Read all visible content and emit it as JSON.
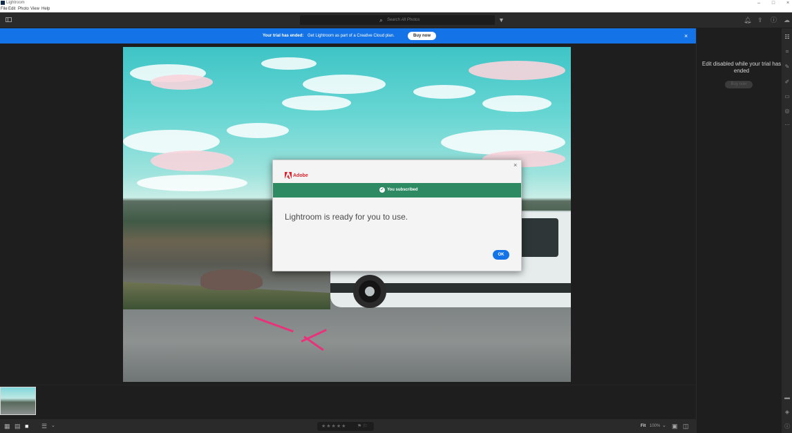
{
  "window": {
    "title": "Lightroom",
    "minimize": "–",
    "maximize": "□",
    "close": "×"
  },
  "menu": [
    "File",
    "Edit",
    "Photo",
    "View",
    "Help"
  ],
  "toolbar": {
    "search_placeholder": "Search All Photos",
    "icons": [
      "panel-toggle-icon",
      "search-icon",
      "filter-icon",
      "bell-icon",
      "share-icon",
      "help-icon",
      "cloud-icon"
    ]
  },
  "banner": {
    "strong": "Your trial has ended:",
    "text": "Get Lightroom as part of a Creative Cloud plan.",
    "button": "Buy now",
    "close": "×",
    "color": "#1473e6"
  },
  "modal": {
    "brand": "Adobe",
    "status": "You subscribed",
    "message": "Lightroom is ready for you to use.",
    "ok": "OK",
    "close": "×",
    "status_color": "#2d8a62",
    "brand_color": "#e0202a"
  },
  "right_panel": {
    "message": "Edit disabled while your trial has ended",
    "button": "Buy now"
  },
  "bottombar": {
    "stars": "★★★★★",
    "flags": "⚑ ⚐",
    "fit": "Fit",
    "zoom": "100%",
    "zoom_caret": "⌄"
  }
}
